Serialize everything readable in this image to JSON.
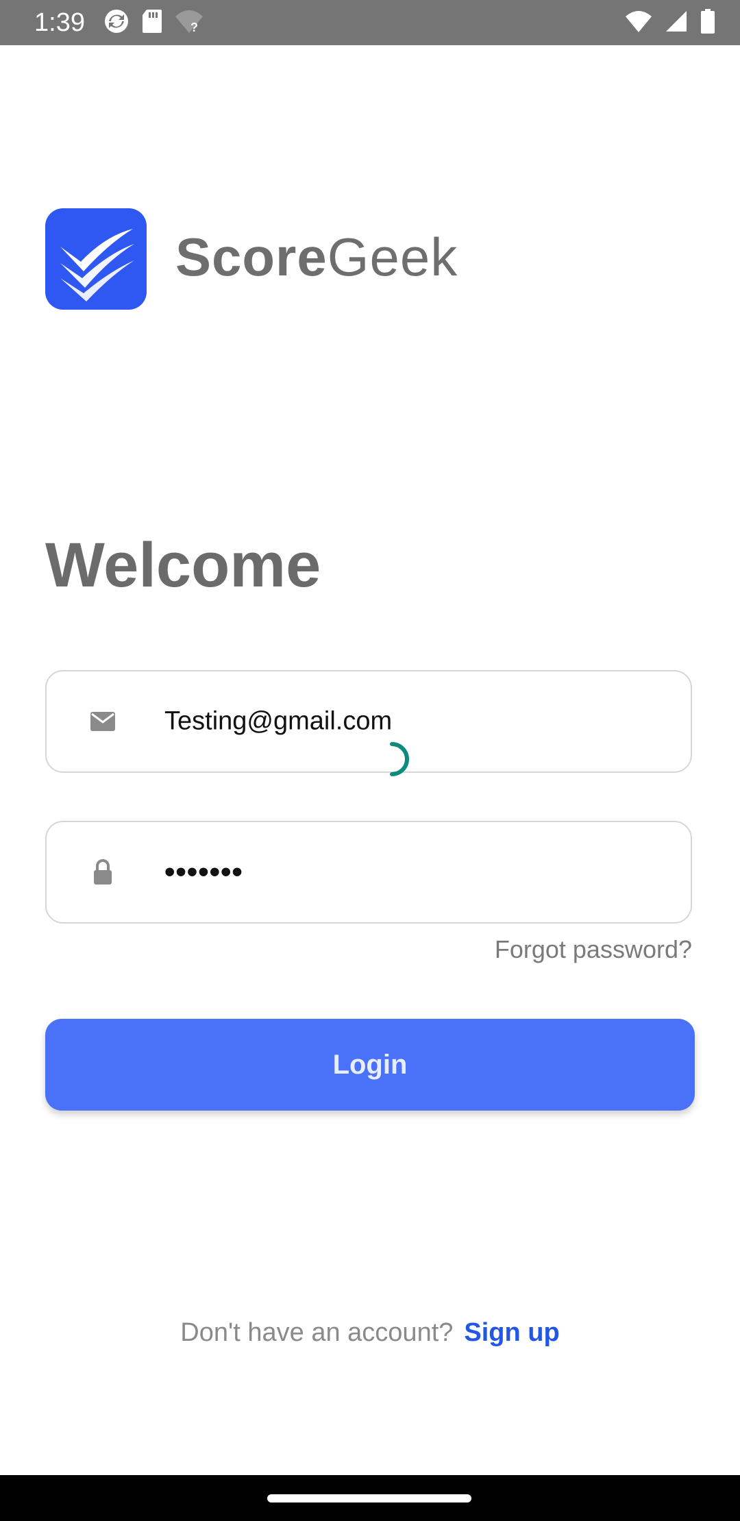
{
  "status_bar": {
    "time": "1:39",
    "left_icons": [
      "sync-icon",
      "sd-card-icon",
      "wifi-question-icon"
    ],
    "right_icons": [
      "wifi-icon",
      "signal-icon",
      "battery-icon"
    ]
  },
  "logo": {
    "icon": "checkmark-stack-icon",
    "brand_bold": "Score",
    "brand_light": "Geek",
    "brand_color": "#2f57f2"
  },
  "welcome": {
    "title": "Welcome"
  },
  "email_field": {
    "icon": "mail-icon",
    "value": "Testing@gmail.com"
  },
  "password_field": {
    "icon": "lock-icon",
    "value": "•••••••"
  },
  "loading_indicator": {
    "icon": "spinner-icon",
    "color": "#0f8a7e"
  },
  "forgot_password": {
    "label": "Forgot password?"
  },
  "login_button": {
    "label": "Login",
    "color": "#4a72f9"
  },
  "signup": {
    "prompt": "Don't have an account?",
    "link_label": "Sign up",
    "link_color": "#2456e6"
  }
}
